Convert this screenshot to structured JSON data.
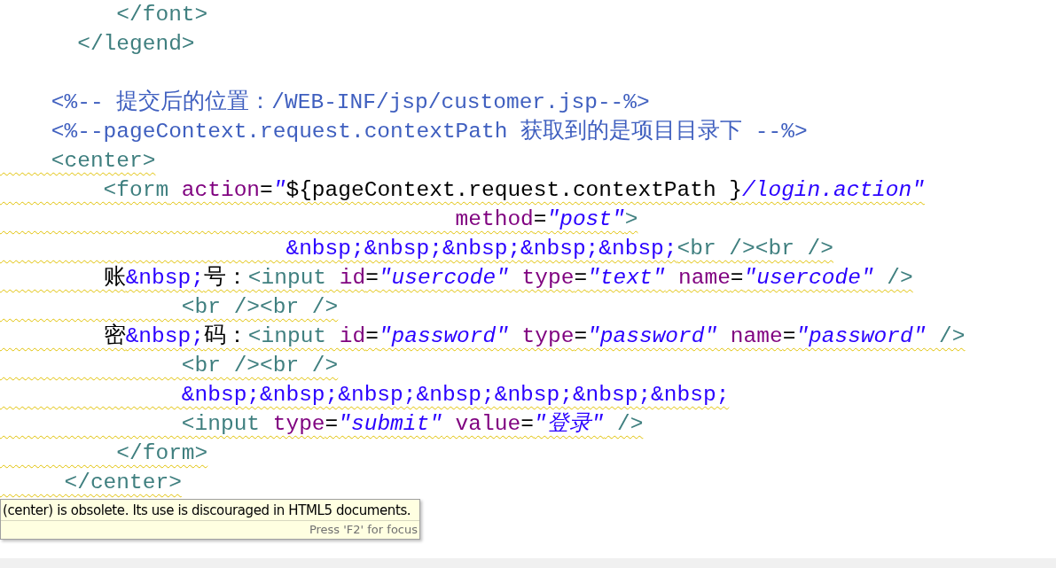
{
  "editor": {
    "lines": [
      {
        "kind": "code",
        "warning": false,
        "tokens": [
          {
            "kind": "tag",
            "text": "         </font>"
          }
        ]
      },
      {
        "kind": "code",
        "warning": false,
        "tokens": [
          {
            "kind": "tag",
            "text": "      </legend>"
          }
        ]
      },
      {
        "kind": "blank"
      },
      {
        "kind": "code",
        "warning": false,
        "tokens": [
          {
            "kind": "comment",
            "text": "    <%-- 提交后的位置：/WEB-INF/jsp/customer.jsp--%>"
          }
        ]
      },
      {
        "kind": "code",
        "warning": false,
        "tokens": [
          {
            "kind": "comment",
            "text": "    <%--pageContext.request.contextPath 获取到的是项目目录下 --%>"
          }
        ]
      },
      {
        "kind": "code",
        "warning": true,
        "tokens": [
          {
            "kind": "tag",
            "text": "    <center>"
          }
        ]
      },
      {
        "kind": "code",
        "warning": true,
        "tokens": [
          {
            "kind": "tag",
            "text": "        <form"
          },
          {
            "kind": "attr",
            "text": " action"
          },
          {
            "kind": "plain",
            "text": "="
          },
          {
            "kind": "value",
            "text": "\""
          },
          {
            "kind": "plain",
            "text": "${pageContext.request.contextPath }"
          },
          {
            "kind": "value",
            "text": "/login.action\""
          }
        ]
      },
      {
        "kind": "code",
        "warning": true,
        "tokens": [
          {
            "kind": "attr",
            "text": "                                   method"
          },
          {
            "kind": "plain",
            "text": "="
          },
          {
            "kind": "value",
            "text": "\"post\""
          },
          {
            "kind": "tag",
            "text": ">"
          }
        ]
      },
      {
        "kind": "code",
        "warning": true,
        "tokens": [
          {
            "kind": "entity",
            "text": "                      &nbsp;&nbsp;&nbsp;&nbsp;&nbsp;"
          },
          {
            "kind": "tag",
            "text": "<br /><br />"
          }
        ]
      },
      {
        "kind": "code",
        "warning": true,
        "tokens": [
          {
            "kind": "plain",
            "text": "        账"
          },
          {
            "kind": "entity",
            "text": "&nbsp;"
          },
          {
            "kind": "plain",
            "text": "号："
          },
          {
            "kind": "tag",
            "text": "<input"
          },
          {
            "kind": "attr",
            "text": " id"
          },
          {
            "kind": "plain",
            "text": "="
          },
          {
            "kind": "value",
            "text": "\"usercode\""
          },
          {
            "kind": "attr",
            "text": " type"
          },
          {
            "kind": "plain",
            "text": "="
          },
          {
            "kind": "value",
            "text": "\"text\""
          },
          {
            "kind": "attr",
            "text": " name"
          },
          {
            "kind": "plain",
            "text": "="
          },
          {
            "kind": "value",
            "text": "\"usercode\""
          },
          {
            "kind": "tag",
            "text": " />"
          }
        ]
      },
      {
        "kind": "code",
        "warning": true,
        "tokens": [
          {
            "kind": "tag",
            "text": "              <br /><br />"
          }
        ]
      },
      {
        "kind": "code",
        "warning": true,
        "tokens": [
          {
            "kind": "plain",
            "text": "        密"
          },
          {
            "kind": "entity",
            "text": "&nbsp;"
          },
          {
            "kind": "plain",
            "text": "码："
          },
          {
            "kind": "tag",
            "text": "<input"
          },
          {
            "kind": "attr",
            "text": " id"
          },
          {
            "kind": "plain",
            "text": "="
          },
          {
            "kind": "value",
            "text": "\"password\""
          },
          {
            "kind": "attr",
            "text": " type"
          },
          {
            "kind": "plain",
            "text": "="
          },
          {
            "kind": "value",
            "text": "\"password\""
          },
          {
            "kind": "attr",
            "text": " name"
          },
          {
            "kind": "plain",
            "text": "="
          },
          {
            "kind": "value",
            "text": "\"password\""
          },
          {
            "kind": "tag",
            "text": " />"
          }
        ]
      },
      {
        "kind": "code",
        "warning": true,
        "tokens": [
          {
            "kind": "tag",
            "text": "              <br /><br />"
          }
        ]
      },
      {
        "kind": "code",
        "warning": true,
        "tokens": [
          {
            "kind": "entity",
            "text": "              &nbsp;&nbsp;&nbsp;&nbsp;&nbsp;&nbsp;&nbsp;"
          }
        ]
      },
      {
        "kind": "code",
        "warning": true,
        "tokens": [
          {
            "kind": "tag",
            "text": "              <input"
          },
          {
            "kind": "attr",
            "text": " type"
          },
          {
            "kind": "plain",
            "text": "="
          },
          {
            "kind": "value",
            "text": "\"submit\""
          },
          {
            "kind": "attr",
            "text": " value"
          },
          {
            "kind": "plain",
            "text": "="
          },
          {
            "kind": "value",
            "text": "\"登录\""
          },
          {
            "kind": "tag",
            "text": " />"
          }
        ]
      },
      {
        "kind": "code",
        "warning": true,
        "tokens": [
          {
            "kind": "tag",
            "text": "         </form>"
          }
        ]
      },
      {
        "kind": "code",
        "warning": true,
        "tokens": [
          {
            "kind": "tag",
            "text": "     </center>"
          }
        ]
      }
    ]
  },
  "tooltip": {
    "message": "(center) is obsolete. Its use is discouraged in HTML5 documents.",
    "hint": "Press 'F2' for focus"
  }
}
